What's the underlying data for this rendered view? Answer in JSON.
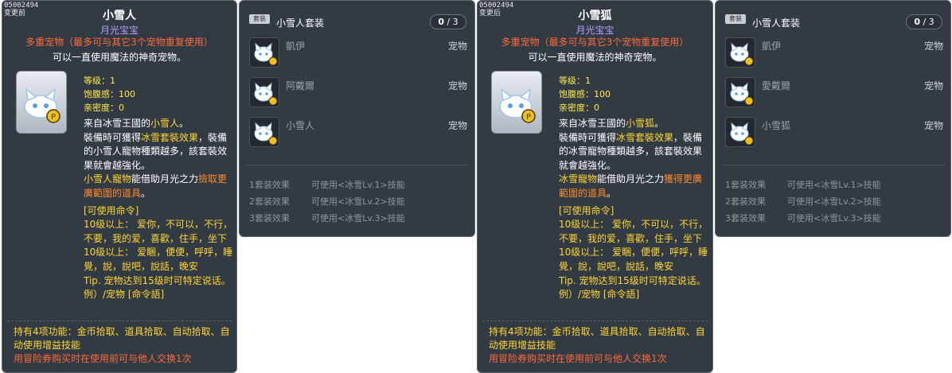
{
  "panels": [
    {
      "code": "05002494",
      "state": "变更前",
      "title": "小雪人",
      "rarity": "月光宝宝",
      "multi": "多重宠物（最多可与其它3个宠物重复使用）",
      "desc": "可以一直使用魔法的神奇宠物。",
      "stats": [
        "等级：1",
        "饱腹感：100",
        "亲密度：0"
      ],
      "body": {
        "l1a": "来自冰雪王國的",
        "l1b": "小雪人",
        "l1c": "。",
        "l2a": "裝備時可獲得",
        "l2b": "冰雪套裝效果",
        "l2c": "，裝備的小雪人寵物種類越多，該套裝效果就會越強化。",
        "l3a": "小雪人寵物",
        "l3b": "能借助月光之力",
        "l3c": "撿取更廣範圍的道具",
        "l3d": "。"
      },
      "cmd_title": "[可使用命令]",
      "cmd1": "10级以上：  爱你，不可以，不行，不要，我的爱，喜歡，住手，坐下",
      "cmd2": "10级以上：  爱睏，便便，呼呼，睡覺，說，說吧，說話，晚安",
      "tip": "Tip. 宠物达到15级时可特定说话。",
      "example": "例）/宠物 [命令語]",
      "foot1": "持有4项功能：金币拾取、道具拾取、自动拾取、自动使用增益技能",
      "foot2": "用冒险券购买时在使用前可与他人交换1次"
    },
    {
      "code": "05002494",
      "state": "变更后",
      "title": "小雪狐",
      "rarity": "月光宝宝",
      "multi": "多重宠物（最多可与其它3个宠物重复使用）",
      "desc": "可以一直使用魔法的神奇宠物。",
      "stats": [
        "等级：1",
        "饱腹感：100",
        "亲密度：0"
      ],
      "body": {
        "l1a": "来自冰雪王國的",
        "l1b": "小雪狐",
        "l1c": "。",
        "l2a": "裝備時可獲得",
        "l2b": "冰雪套裝效果",
        "l2c": "，裝備的冰雪寵物種類越多，該套裝效果就會越強化。",
        "l3a": "冰雪寵物",
        "l3b": "能借助月光之力",
        "l3c": "獲得更廣範圍的道具",
        "l3d": "。"
      },
      "cmd_title": "[可使用命令]",
      "cmd1": "10级以上：  爱你，不可以，不行，不要，我的爱，喜歡，住手，坐下",
      "cmd2": "10级以上：  爱睏，便便，呼呼，睡覺，說，說吧，說話，晚安",
      "tip": "Tip. 宠物达到15级时可特定说话。",
      "example": "例）/宠物 [命令語]",
      "foot1": "持有4项功能：金币拾取、道具拾取、自动拾取、自动使用增益技能",
      "foot2": "用冒险券购买时在使用前可与他人交换1次"
    }
  ],
  "sets": [
    {
      "badge": "套装",
      "name": "小雪人套装",
      "count_have": "0",
      "count_sep": " / ",
      "count_total": "3",
      "items": [
        {
          "name": "凱伊",
          "type": "宠物"
        },
        {
          "name": "阿戴爾",
          "type": "宠物"
        },
        {
          "name": "小雪人",
          "type": "宠物"
        }
      ],
      "effects": [
        {
          "k": "1套装效果",
          "v": "可使用<冰雪Lv.1>技能"
        },
        {
          "k": "2套装效果",
          "v": "可使用<冰雪Lv.2>技能"
        },
        {
          "k": "3套装效果",
          "v": "可使用<冰雪Lv.3>技能"
        }
      ]
    },
    {
      "badge": "套装",
      "name": "小雪人套装",
      "count_have": "0",
      "count_sep": " / ",
      "count_total": "3",
      "items": [
        {
          "name": "凱伊",
          "type": "宠物"
        },
        {
          "name": "愛戴爾",
          "type": "宠物"
        },
        {
          "name": "小雪狐",
          "type": "宠物"
        }
      ],
      "effects": [
        {
          "k": "1套装效果",
          "v": "可使用<冰雪Lv.1>技能"
        },
        {
          "k": "2套装效果",
          "v": "可使用<冰雪Lv.2>技能"
        },
        {
          "k": "3套装效果",
          "v": "可使用<冰雪Lv.3>技能"
        }
      ]
    }
  ],
  "colors": {
    "panel_bg": "#323a44",
    "rarity": "#b99dff",
    "warning": "#ff6a3a",
    "highlight": "#ffd633",
    "muted": "#8e969f"
  },
  "icons": [
    "snow-fox-pet-icon",
    "pet-badge-icon",
    "set-badge-icon"
  ]
}
